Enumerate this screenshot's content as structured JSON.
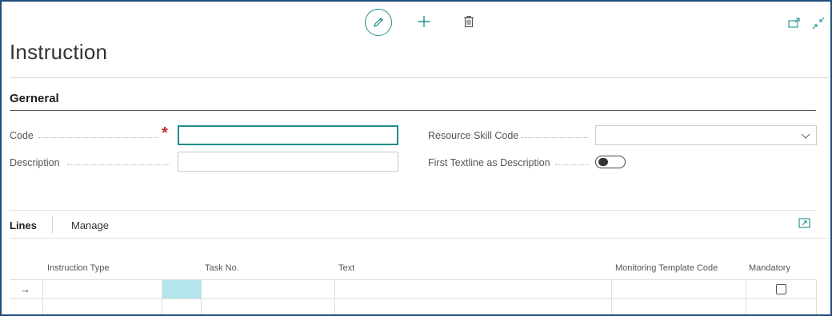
{
  "page": {
    "title": "Instruction"
  },
  "toolbar": {
    "edit_icon": "pencil-icon",
    "new_icon": "plus-icon",
    "delete_icon": "trash-icon",
    "popout_icon": "open-in-new-window-icon",
    "collapse_icon": "collapse-icon",
    "accent": "#1e8c8c"
  },
  "general": {
    "heading": "Gerneral",
    "code_label": "Code",
    "code_value": "",
    "description_label": "Description",
    "description_value": "",
    "resource_skill_code_label": "Resource Skill Code",
    "resource_skill_code_value": "",
    "first_textline_label": "First Textline as Description",
    "first_textline_on": false
  },
  "lines": {
    "tabs": [
      "Lines",
      "Manage"
    ],
    "columns": [
      "Instruction Type",
      "Task No.",
      "Text",
      "Monitoring Template Code",
      "Mandatory"
    ],
    "rows": [
      {
        "instruction_type": "",
        "task_no": "",
        "text": "",
        "monitoring_template_code": "",
        "mandatory": false
      }
    ],
    "selected_cell_color": "#b3e5eb"
  }
}
